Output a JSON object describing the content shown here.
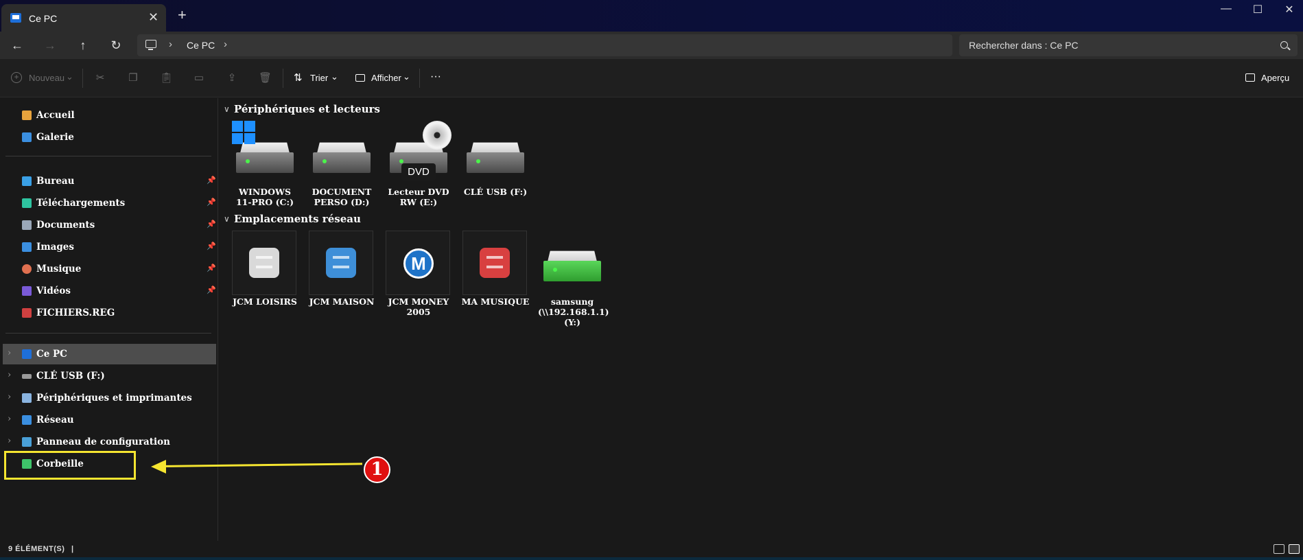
{
  "window": {
    "tab_title": "Ce PC",
    "close_glyph": "✕",
    "new_tab_glyph": "+",
    "minimize_glyph": "—",
    "maximize_glyph": "☐",
    "close_window_glyph": "✕"
  },
  "nav": {
    "back": "←",
    "forward": "→",
    "up": "↑",
    "refresh": "↻",
    "breadcrumb": [
      "Ce PC"
    ],
    "chevron": "›",
    "search_placeholder": "Rechercher dans : Ce PC"
  },
  "commands": {
    "new_label": "Nouveau",
    "sort_label": "Trier",
    "view_label": "Afficher",
    "more_label": "···",
    "preview_label": "Aperçu",
    "dropdown_glyph": "⌄"
  },
  "sidebar": {
    "quick": [
      {
        "label": "Accueil",
        "color": "#e8a33d"
      },
      {
        "label": "Galerie",
        "color": "#3b8fe0"
      }
    ],
    "pinned": [
      {
        "label": "Bureau",
        "color": "#3aa0e6"
      },
      {
        "label": "Téléchargements",
        "color": "#2ec4a0"
      },
      {
        "label": "Documents",
        "color": "#9aa7b8"
      },
      {
        "label": "Images",
        "color": "#3b8fe0"
      },
      {
        "label": "Musique",
        "color": "#e07050"
      },
      {
        "label": "Vidéos",
        "color": "#7a5ad8"
      },
      {
        "label": "FICHIERS.REG",
        "color": "#d04040"
      }
    ],
    "pin_glyph": "📌",
    "tree": [
      {
        "label": "Ce PC",
        "color": "#1e6fd9",
        "selected": true
      },
      {
        "label": "CLÉ USB (F:)",
        "color": "#9a9a9a"
      },
      {
        "label": "Périphériques et imprimantes",
        "color": "#8ab4e0"
      },
      {
        "label": "Réseau",
        "color": "#3b8fe0"
      },
      {
        "label": "Panneau de configuration",
        "color": "#4aa0d8"
      },
      {
        "label": "Corbeille",
        "color": "#3ec46a"
      }
    ],
    "expand_glyph": "›"
  },
  "annotation": {
    "badge": "1",
    "color": "#f5e530"
  },
  "main": {
    "sections": [
      {
        "title": "Périphériques et lecteurs"
      },
      {
        "title": "Emplacements réseau"
      }
    ],
    "chevron": "∨",
    "drives": [
      {
        "line1": "WINDOWS",
        "line2": "11-PRO (C:)"
      },
      {
        "line1": "DOCUMENT",
        "line2": "PERSO (D:)"
      },
      {
        "line1": "Lecteur DVD",
        "line2": "RW (E:)",
        "badge": "DVD"
      },
      {
        "line1": "CLÉ USB (F:)",
        "line2": ""
      }
    ],
    "network": [
      {
        "line1": "JCM LOISIRS",
        "line2": "",
        "color": "#d9d9d9"
      },
      {
        "line1": "JCM MAISON",
        "line2": "",
        "color": "#3e8fd8"
      },
      {
        "line1": "JCM MONEY",
        "line2": "2005",
        "logo": "M"
      },
      {
        "line1": "MA MUSIQUE",
        "line2": "",
        "color": "#d84040"
      },
      {
        "line1": "samsung",
        "line2": "(\\\\192.168.1.1)",
        "line3": "(Y:)"
      }
    ]
  },
  "status": {
    "count_text": "9 élément(s)",
    "sep": "|"
  }
}
